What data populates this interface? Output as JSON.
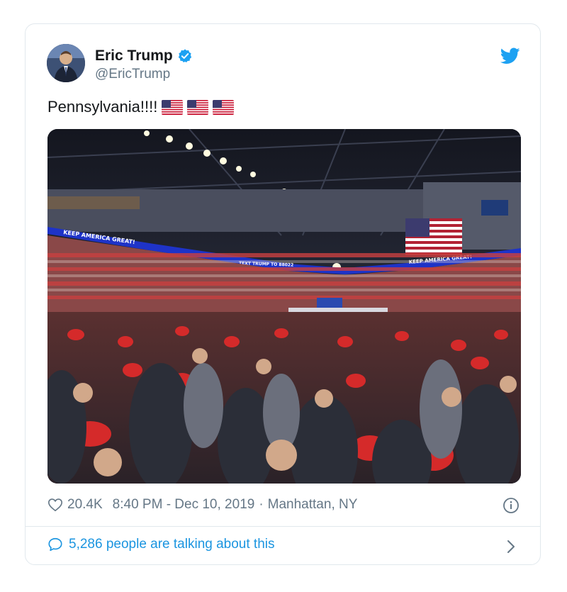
{
  "tweet": {
    "author": {
      "display_name": "Eric Trump",
      "handle": "@EricTrump",
      "verified": true
    },
    "text": "Pennsylvania!!!!",
    "emoji": [
      "us-flag",
      "us-flag",
      "us-flag"
    ],
    "image": {
      "banner_texts": [
        "KEEP AMERICA GREAT!",
        "TEXT TRUMP TO 88022",
        "KEEP AMERICA GREAT!"
      ]
    },
    "likes": "20.4K",
    "timestamp": "8:40 PM - Dec 10, 2019",
    "separator": "·",
    "location": "Manhattan, NY",
    "conversation": "5,286 people are talking about this"
  },
  "colors": {
    "link_blue": "#1b95e0",
    "twitter_blue": "#1da1f2",
    "muted": "#657786",
    "border": "#e1e8ed"
  },
  "icons": [
    "verified-badge-icon",
    "twitter-bird-icon",
    "heart-icon",
    "info-icon",
    "speech-bubble-icon",
    "chevron-right-icon"
  ]
}
